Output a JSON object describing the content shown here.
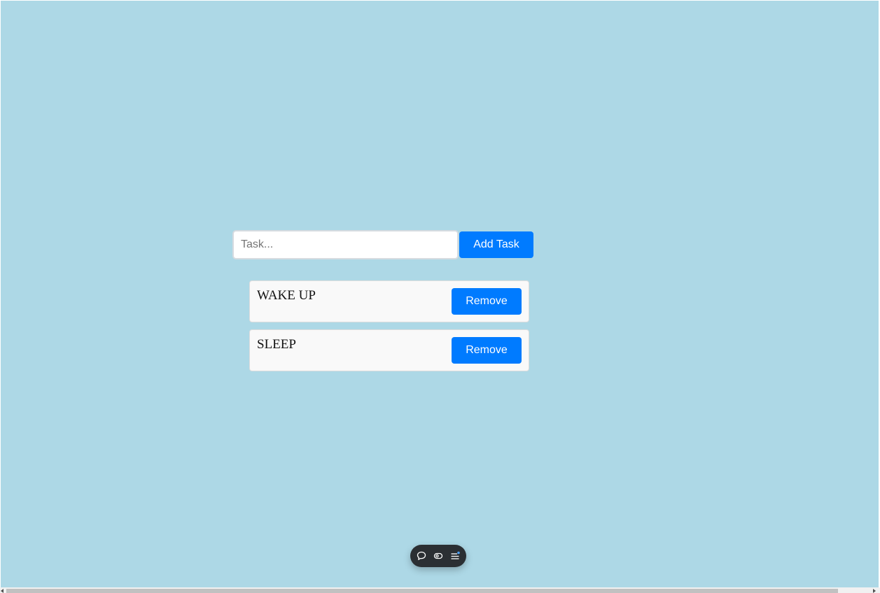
{
  "form": {
    "input_placeholder": "Task...",
    "input_value": "",
    "add_button_label": "Add Task"
  },
  "tasks": [
    {
      "text": "WAKE UP",
      "remove_label": "Remove"
    },
    {
      "text": "SLEEP",
      "remove_label": "Remove"
    }
  ],
  "toolbar": {
    "icons": [
      "chat-bubble-icon",
      "eye-toggle-icon",
      "menu-icon"
    ]
  },
  "colors": {
    "background": "#add8e6",
    "accent": "#007bff",
    "task_card": "#f9f9f9",
    "toolbar": "#2b2f33"
  }
}
